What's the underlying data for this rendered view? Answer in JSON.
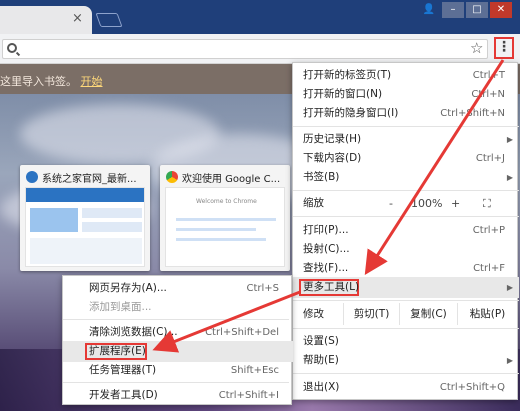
{
  "browser": {
    "tab_close_glyph": "×",
    "window_buttons": [
      "user",
      "minimize",
      "maximize",
      "close"
    ],
    "address_value": "",
    "icons": {
      "search": "search-icon",
      "star": "star-icon",
      "menu": "kebab-menu-icon"
    }
  },
  "bookmark_bar": {
    "prompt": "这里导入书签。",
    "link": "开始"
  },
  "thumbnails": [
    {
      "title": "系统之家官网_最新...",
      "icon": "site-logo-icon",
      "color": "#2b73c2"
    },
    {
      "title": "欢迎使用 Google C...",
      "icon": "chrome-icon",
      "color": "#ea4335",
      "page_heading": "Welcome to Chrome"
    }
  ],
  "menu": {
    "items": [
      {
        "label": "打开新的标签页(T)",
        "shortcut": "Ctrl+T"
      },
      {
        "label": "打开新的窗口(N)",
        "shortcut": "Ctrl+N"
      },
      {
        "label": "打开新的隐身窗口(I)",
        "shortcut": "Ctrl+Shift+N"
      },
      {
        "label": "历史记录(H)",
        "arrow": "▶"
      },
      {
        "label": "下载内容(D)",
        "shortcut": "Ctrl+J"
      },
      {
        "label": "书签(B)",
        "arrow": "▶"
      },
      {
        "label": "打印(P)...",
        "shortcut": "Ctrl+P"
      },
      {
        "label": "投射(C)..."
      },
      {
        "label": "查找(F)...",
        "shortcut": "Ctrl+F"
      },
      {
        "label": "更多工具(L)",
        "arrow": "▶"
      },
      {
        "label": "设置(S)"
      },
      {
        "label": "帮助(E)",
        "arrow": "▶"
      },
      {
        "label": "退出(X)",
        "shortcut": "Ctrl+Shift+Q"
      }
    ],
    "zoom": {
      "label": "缩放",
      "minus": "-",
      "value": "100%",
      "plus": "+",
      "fullscreen": "⛶"
    },
    "edit": {
      "label": "修改",
      "cut": "剪切(T)",
      "copy": "复制(C)",
      "paste": "粘贴(P)"
    }
  },
  "submenu": {
    "items": [
      {
        "label": "网页另存为(A)...",
        "shortcut": "Ctrl+S"
      },
      {
        "label": "添加到桌面..."
      },
      {
        "label": "清除浏览数据(C)...",
        "shortcut": "Ctrl+Shift+Del"
      },
      {
        "label": "扩展程序(E)"
      },
      {
        "label": "任务管理器(T)",
        "shortcut": "Shift+Esc"
      },
      {
        "label": "开发者工具(D)",
        "shortcut": "Ctrl+Shift+I"
      }
    ]
  },
  "colors": {
    "highlight": "#e53935",
    "title_bar": "#1f3f7a"
  }
}
